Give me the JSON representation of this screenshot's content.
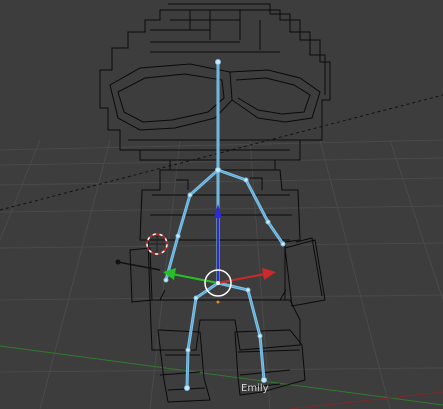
{
  "viewport": {
    "background": "#3d3d3d",
    "grid_color": "#4a4a4a",
    "wire_color": "#0a0a0a",
    "bone_outline_color": "#7fc4ea",
    "bone_core_color": "#5fa8d6",
    "axis_colors": {
      "x": "#cc2a2a",
      "y": "#26c026",
      "z": "#2b2bd8"
    },
    "x_axis_line_color": "#7a2a2a",
    "y_axis_line_color": "#2f7a2f",
    "cursor_colors": [
      "#cc2222",
      "#ffffff"
    ],
    "object_label": "Emily"
  },
  "widgets": {
    "transform_manipulator": "translate-manipulator-icon",
    "cursor_3d": "3d-cursor-icon",
    "pivot": "pivot-point-icon",
    "camera_line": "camera-direction-line"
  }
}
